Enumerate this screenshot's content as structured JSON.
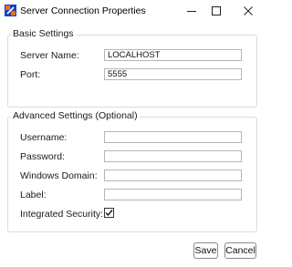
{
  "window": {
    "title": "Server Connection Properties"
  },
  "basic": {
    "legend": "Basic Settings",
    "server_label": "Server Name:",
    "server_value": "LOCALHOST",
    "port_label": "Port:",
    "port_value": "5555"
  },
  "advanced": {
    "legend": "Advanced Settings (Optional)",
    "username_label": "Username:",
    "username_value": "",
    "password_label": "Password:",
    "password_value": "",
    "domain_label": "Windows Domain:",
    "domain_value": "",
    "label_label": "Label:",
    "label_value": "",
    "integrated_label": "Integrated Security:",
    "integrated_checked": true
  },
  "buttons": {
    "save": "Save",
    "cancel": "Cancel"
  },
  "icons": {
    "app": "server-app-icon",
    "minimize": "minimize-icon",
    "maximize": "maximize-icon",
    "close": "close-icon",
    "check": "checkmark-icon"
  },
  "colors": {
    "app_icon_blue": "#1f3fb3",
    "app_icon_orange": "#e8711c",
    "border": "#dcdcdc"
  }
}
